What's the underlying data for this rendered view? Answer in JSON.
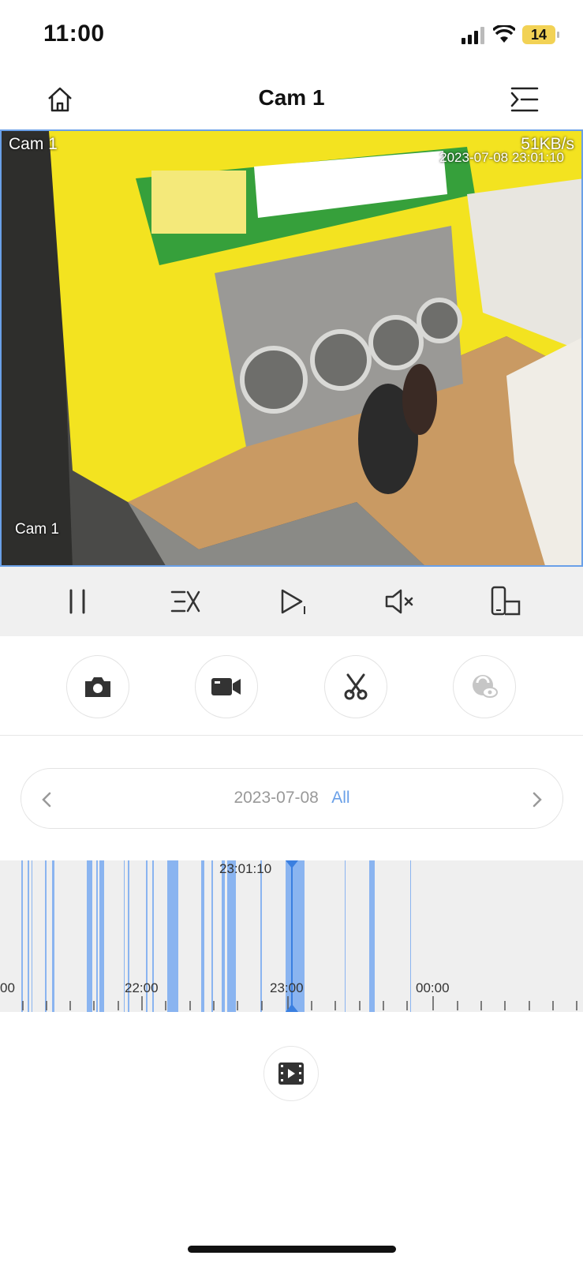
{
  "status_bar": {
    "time": "11:00",
    "battery": "14"
  },
  "header": {
    "title": "Cam 1"
  },
  "video": {
    "channel_label_top": "Cam 1",
    "bitrate": "51KB/s",
    "timestamp": "2023-07-08 23:01:10",
    "channel_label_bottom": "Cam 1"
  },
  "date_selector": {
    "date": "2023-07-08",
    "filter": "All"
  },
  "timeline": {
    "current_time": "23:01:10",
    "labels": [
      "00",
      "22:00",
      "23:00",
      "00:00"
    ]
  },
  "colors": {
    "accent": "#6aa0e8",
    "recording": "#8ab4f0"
  }
}
